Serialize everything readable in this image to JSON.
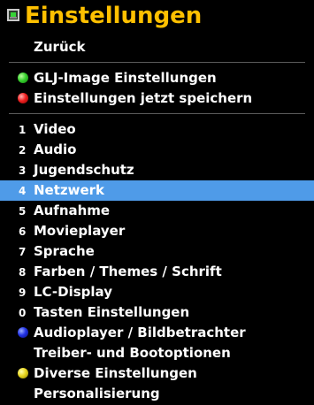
{
  "header": {
    "title": "Einstellungen",
    "icon": "settings-screen-icon"
  },
  "menu": {
    "back_label": "Zurück",
    "special_items": [
      {
        "label": "GLJ-Image Einstellungen",
        "color": "green"
      },
      {
        "label": "Einstellungen jetzt speichern",
        "color": "red"
      }
    ],
    "items": [
      {
        "number": "1",
        "label": "Video"
      },
      {
        "number": "2",
        "label": "Audio"
      },
      {
        "number": "3",
        "label": "Jugendschutz"
      },
      {
        "number": "4",
        "label": "Netzwerk",
        "selected": true
      },
      {
        "number": "5",
        "label": "Aufnahme"
      },
      {
        "number": "6",
        "label": "Movieplayer"
      },
      {
        "number": "7",
        "label": "Sprache"
      },
      {
        "number": "8",
        "label": "Farben / Themes / Schrift"
      },
      {
        "number": "9",
        "label": "LC-Display"
      },
      {
        "number": "0",
        "label": "Tasten Einstellungen"
      },
      {
        "number": "",
        "label": "Audioplayer / Bildbetrachter",
        "color": "blue"
      },
      {
        "number": "",
        "label": "Treiber- und Bootoptionen"
      },
      {
        "number": "",
        "label": "Diverse Einstellungen",
        "color": "yellow"
      },
      {
        "number": "",
        "label": "Personalisierung"
      }
    ]
  },
  "colors": {
    "title": "#ffc000",
    "selection": "#4f9be8",
    "background": "#000000",
    "text": "#ffffff"
  }
}
